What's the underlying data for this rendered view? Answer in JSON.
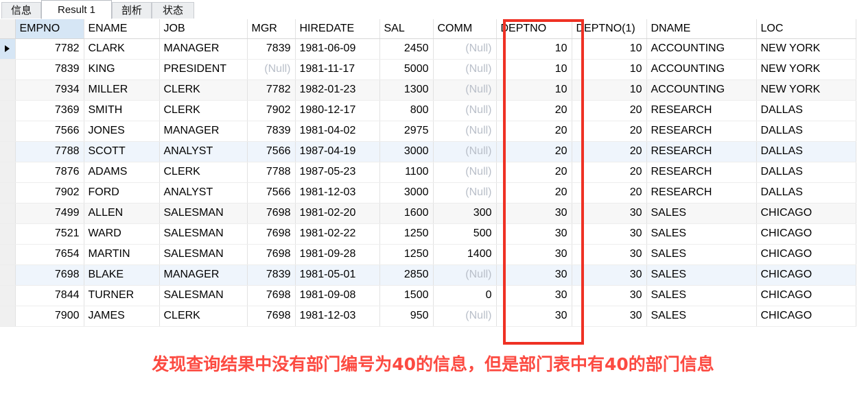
{
  "tabs": [
    {
      "label": "信息",
      "active": false
    },
    {
      "label": "Result 1",
      "active": true
    },
    {
      "label": "剖析",
      "active": false
    },
    {
      "label": "状态",
      "active": false
    }
  ],
  "grid": {
    "columns": [
      "EMPNO",
      "ENAME",
      "JOB",
      "MGR",
      "HIREDATE",
      "SAL",
      "COMM",
      "DEPTNO",
      "DEPTNO(1)",
      "DNAME",
      "LOC"
    ],
    "selected_column": "EMPNO",
    "current_row_index": 0,
    "null_text": "(Null)",
    "rows": [
      {
        "EMPNO": "7782",
        "ENAME": "CLARK",
        "JOB": "MANAGER",
        "MGR": "7839",
        "HIREDATE": "1981-06-09",
        "SAL": "2450",
        "COMM": "(Null)",
        "DEPTNO": "10",
        "DEPTNO1": "10",
        "DNAME": "ACCOUNTING",
        "LOC": "NEW YORK"
      },
      {
        "EMPNO": "7839",
        "ENAME": "KING",
        "JOB": "PRESIDENT",
        "MGR": "(Null)",
        "HIREDATE": "1981-11-17",
        "SAL": "5000",
        "COMM": "(Null)",
        "DEPTNO": "10",
        "DEPTNO1": "10",
        "DNAME": "ACCOUNTING",
        "LOC": "NEW YORK"
      },
      {
        "EMPNO": "7934",
        "ENAME": "MILLER",
        "JOB": "CLERK",
        "MGR": "7782",
        "HIREDATE": "1982-01-23",
        "SAL": "1300",
        "COMM": "(Null)",
        "DEPTNO": "10",
        "DEPTNO1": "10",
        "DNAME": "ACCOUNTING",
        "LOC": "NEW YORK"
      },
      {
        "EMPNO": "7369",
        "ENAME": "SMITH",
        "JOB": "CLERK",
        "MGR": "7902",
        "HIREDATE": "1980-12-17",
        "SAL": "800",
        "COMM": "(Null)",
        "DEPTNO": "20",
        "DEPTNO1": "20",
        "DNAME": "RESEARCH",
        "LOC": "DALLAS"
      },
      {
        "EMPNO": "7566",
        "ENAME": "JONES",
        "JOB": "MANAGER",
        "MGR": "7839",
        "HIREDATE": "1981-04-02",
        "SAL": "2975",
        "COMM": "(Null)",
        "DEPTNO": "20",
        "DEPTNO1": "20",
        "DNAME": "RESEARCH",
        "LOC": "DALLAS"
      },
      {
        "EMPNO": "7788",
        "ENAME": "SCOTT",
        "JOB": "ANALYST",
        "MGR": "7566",
        "HIREDATE": "1987-04-19",
        "SAL": "3000",
        "COMM": "(Null)",
        "DEPTNO": "20",
        "DEPTNO1": "20",
        "DNAME": "RESEARCH",
        "LOC": "DALLAS"
      },
      {
        "EMPNO": "7876",
        "ENAME": "ADAMS",
        "JOB": "CLERK",
        "MGR": "7788",
        "HIREDATE": "1987-05-23",
        "SAL": "1100",
        "COMM": "(Null)",
        "DEPTNO": "20",
        "DEPTNO1": "20",
        "DNAME": "RESEARCH",
        "LOC": "DALLAS"
      },
      {
        "EMPNO": "7902",
        "ENAME": "FORD",
        "JOB": "ANALYST",
        "MGR": "7566",
        "HIREDATE": "1981-12-03",
        "SAL": "3000",
        "COMM": "(Null)",
        "DEPTNO": "20",
        "DEPTNO1": "20",
        "DNAME": "RESEARCH",
        "LOC": "DALLAS"
      },
      {
        "EMPNO": "7499",
        "ENAME": "ALLEN",
        "JOB": "SALESMAN",
        "MGR": "7698",
        "HIREDATE": "1981-02-20",
        "SAL": "1600",
        "COMM": "300",
        "DEPTNO": "30",
        "DEPTNO1": "30",
        "DNAME": "SALES",
        "LOC": "CHICAGO"
      },
      {
        "EMPNO": "7521",
        "ENAME": "WARD",
        "JOB": "SALESMAN",
        "MGR": "7698",
        "HIREDATE": "1981-02-22",
        "SAL": "1250",
        "COMM": "500",
        "DEPTNO": "30",
        "DEPTNO1": "30",
        "DNAME": "SALES",
        "LOC": "CHICAGO"
      },
      {
        "EMPNO": "7654",
        "ENAME": "MARTIN",
        "JOB": "SALESMAN",
        "MGR": "7698",
        "HIREDATE": "1981-09-28",
        "SAL": "1250",
        "COMM": "1400",
        "DEPTNO": "30",
        "DEPTNO1": "30",
        "DNAME": "SALES",
        "LOC": "CHICAGO"
      },
      {
        "EMPNO": "7698",
        "ENAME": "BLAKE",
        "JOB": "MANAGER",
        "MGR": "7839",
        "HIREDATE": "1981-05-01",
        "SAL": "2850",
        "COMM": "(Null)",
        "DEPTNO": "30",
        "DEPTNO1": "30",
        "DNAME": "SALES",
        "LOC": "CHICAGO"
      },
      {
        "EMPNO": "7844",
        "ENAME": "TURNER",
        "JOB": "SALESMAN",
        "MGR": "7698",
        "HIREDATE": "1981-09-08",
        "SAL": "1500",
        "COMM": "0",
        "DEPTNO": "30",
        "DEPTNO1": "30",
        "DNAME": "SALES",
        "LOC": "CHICAGO"
      },
      {
        "EMPNO": "7900",
        "ENAME": "JAMES",
        "JOB": "CLERK",
        "MGR": "7698",
        "HIREDATE": "1981-12-03",
        "SAL": "950",
        "COMM": "(Null)",
        "DEPTNO": "30",
        "DEPTNO1": "30",
        "DNAME": "SALES",
        "LOC": "CHICAGO"
      }
    ]
  },
  "annotation": {
    "highlight_column": "DEPTNO",
    "highlight_color": "#ef3124",
    "caption": "发现查询结果中没有部门编号为40的信息，但是部门表中有40的部门信息",
    "caption_color": "#fc4a41"
  }
}
